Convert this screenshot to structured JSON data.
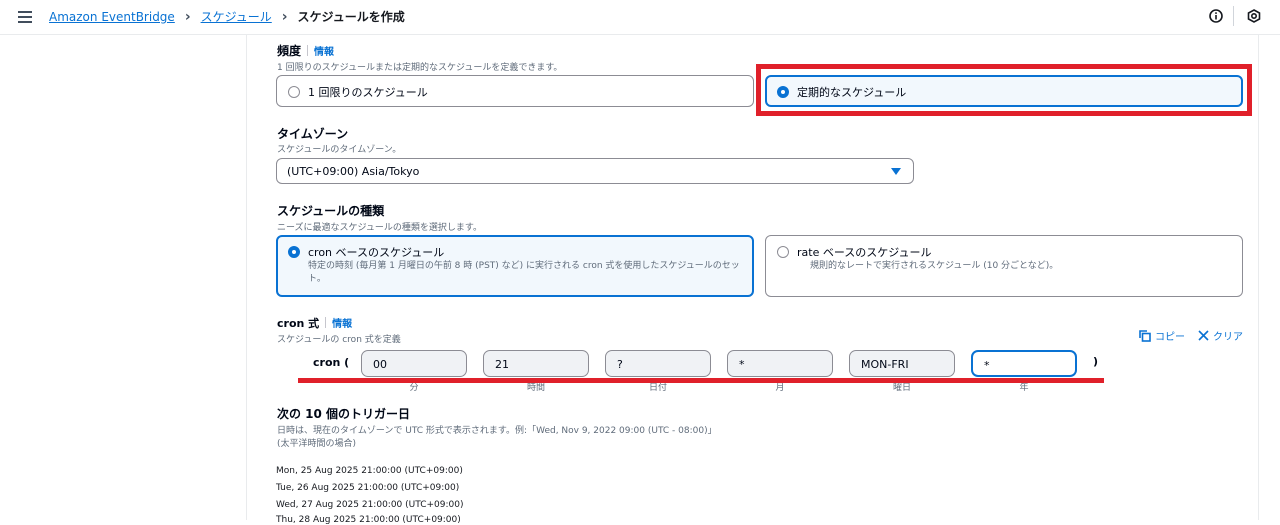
{
  "breadcrumb": {
    "root": "Amazon EventBridge",
    "section": "スケジュール",
    "current": "スケジュールを作成"
  },
  "frequency": {
    "label": "頻度",
    "info": "情報",
    "description": "1 回限りのスケジュールまたは定期的なスケジュールを定義できます。",
    "options": [
      {
        "label": "1 回限りのスケジュール",
        "selected": false
      },
      {
        "label": "定期的なスケジュール",
        "selected": true
      }
    ]
  },
  "timezone": {
    "label": "タイムゾーン",
    "description": "スケジュールのタイムゾーン。",
    "value": "(UTC+09:00) Asia/Tokyo"
  },
  "schedule_type": {
    "label": "スケジュールの種類",
    "description": "ニーズに最適なスケジュールの種類を選択します。",
    "options": [
      {
        "title": "cron ベースのスケジュール",
        "subtitle": "特定の時刻 (毎月第 1 月曜日の午前 8 時 (PST) など) に実行される cron 式を使用したスケジュールのセット。",
        "selected": true
      },
      {
        "title": "rate ベースのスケジュール",
        "subtitle": "規則的なレートで実行されるスケジュール (10 分ごとなど)。",
        "selected": false
      }
    ]
  },
  "cron": {
    "label": "cron 式",
    "info": "情報",
    "description": "スケジュールの cron 式を定義",
    "prefix": "cron (",
    "suffix": ")",
    "copy_label": "コピー",
    "clear_label": "クリア",
    "fields": [
      {
        "value": "00",
        "label": "分"
      },
      {
        "value": "21",
        "label": "時間"
      },
      {
        "value": "?",
        "label": "日付"
      },
      {
        "value": "*",
        "label": "月"
      },
      {
        "value": "MON-FRI",
        "label": "曜日"
      },
      {
        "value": "*",
        "label": "年"
      }
    ]
  },
  "triggers": {
    "label": "次の 10 個のトリガー日",
    "description1": "日時は、現在のタイムゾーンで UTC 形式で表示されます。例:「Wed, Nov 9, 2022 09:00 (UTC - 08:00)」",
    "description2": "(太平洋時間の場合)",
    "dates": [
      "Mon, 25 Aug 2025 21:00:00 (UTC+09:00)",
      "Tue, 26 Aug 2025 21:00:00 (UTC+09:00)",
      "Wed, 27 Aug 2025 21:00:00 (UTC+09:00)",
      "Thu, 28 Aug 2025 21:00:00 (UTC+09:00)"
    ]
  },
  "colors": {
    "accent": "#0972d3",
    "highlight": "#e0202a"
  }
}
